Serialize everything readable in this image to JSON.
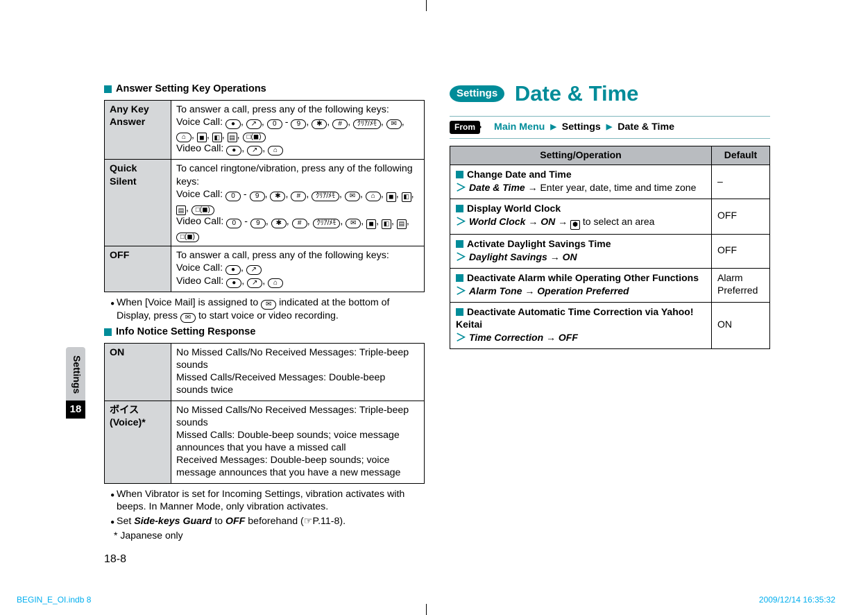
{
  "sideTab": {
    "label": "Settings",
    "chapter": "18"
  },
  "pageNumber": "18-8",
  "printFooter": {
    "left": "BEGIN_E_OI.indb   8",
    "right": "2009/12/14   16:35:32"
  },
  "left": {
    "section1": {
      "title": "Answer Setting Key Operations",
      "rows": [
        {
          "label": "Any Key Answer",
          "text_intro": "To answer a call, press any of the following keys:",
          "voice_label": "Voice Call:",
          "voice_keys": [
            "●",
            "↗",
            "0",
            "-",
            "9",
            "✱",
            "#",
            "ｸﾘｱ/ﾒﾓ",
            "✉",
            "⌂",
            "◼",
            "◧",
            "▤",
            "□(◼)"
          ],
          "video_label": "Video Call:",
          "video_keys": [
            "●",
            "↗",
            "⌂"
          ]
        },
        {
          "label": "Quick Silent",
          "text_intro": "To cancel ringtone/vibration, press any of the following keys:",
          "voice_label": "Voice Call:",
          "voice_keys": [
            "0",
            "-",
            "9",
            "✱",
            "#",
            "ｸﾘｱ/ﾒﾓ",
            "✉",
            "⌂",
            "◼",
            "◧",
            "▤",
            "□(◼)"
          ],
          "video_label": "Video Call:",
          "video_keys": [
            "0",
            "-",
            "9",
            "✱",
            "#",
            "ｸﾘｱ/ﾒﾓ",
            "✉",
            "◼",
            "◧",
            "▤",
            "□(◼)"
          ]
        },
        {
          "label": "OFF",
          "text_intro": "To answer a call, press any of the following keys:",
          "voice_label": "Voice Call:",
          "voice_keys": [
            "●",
            "↗"
          ],
          "video_label": "Video Call:",
          "video_keys": [
            "●",
            "↗",
            "⌂"
          ]
        }
      ],
      "note_prefix": "When [Voice Mail] is assigned to ",
      "note_mid": " indicated at the bottom of Display, press ",
      "note_suffix": " to start voice or video recording.",
      "note_icon": "✉"
    },
    "section2": {
      "title": "Info Notice Setting Response",
      "rows": [
        {
          "label": "ON",
          "lines": [
            "No Missed Calls/No Received Messages: Triple-beep sounds",
            "Missed Calls/Received Messages: Double-beep sounds twice"
          ]
        },
        {
          "label": "ボイス (Voice)*",
          "lines": [
            "No Missed Calls/No Received Messages: Triple-beep sounds",
            "Missed Calls: Double-beep sounds; voice message announces that you have a missed call",
            "Received Messages: Double-beep sounds; voice message announces that you have a new message"
          ]
        }
      ],
      "bullet1": "When Vibrator is set for Incoming Settings, vibration activates with beeps. In Manner Mode, only vibration activates.",
      "bullet2_prefix": "Set ",
      "bullet2_key1": "Side-keys Guard",
      "bullet2_mid": " to ",
      "bullet2_key2": "OFF",
      "bullet2_suffix": " beforehand (☞P.11-8).",
      "footnote": "* Japanese only"
    }
  },
  "right": {
    "badge": "Settings",
    "title": "Date & Time",
    "from": {
      "label": "From",
      "path": [
        "Main Menu",
        "Settings",
        "Date & Time"
      ]
    },
    "table": {
      "h1": "Setting/Operation",
      "h2": "Default",
      "rows": [
        {
          "head": "Change Date and Time",
          "path_emph": "Date & Time",
          "path_rest": " → Enter year, date, time and time zone",
          "default": "–"
        },
        {
          "head": "Display World Clock",
          "path_emph": "World Clock",
          "path_rest": " → ON → ",
          "path_tail": " to select an area",
          "icon": "⬢",
          "default": "OFF"
        },
        {
          "head": "Activate Daylight Savings Time",
          "path_emph": "Daylight Savings",
          "path_rest": " → ON",
          "default": "OFF"
        },
        {
          "head": "Deactivate Alarm while Operating Other Functions",
          "path_emph": "Alarm Tone",
          "path_rest": " → Operation Preferred",
          "default": "Alarm Preferred"
        },
        {
          "head": "Deactivate Automatic Time Correction via Yahoo! Keitai",
          "path_emph": "Time Correction",
          "path_rest": " → OFF",
          "default": "ON"
        }
      ]
    }
  }
}
